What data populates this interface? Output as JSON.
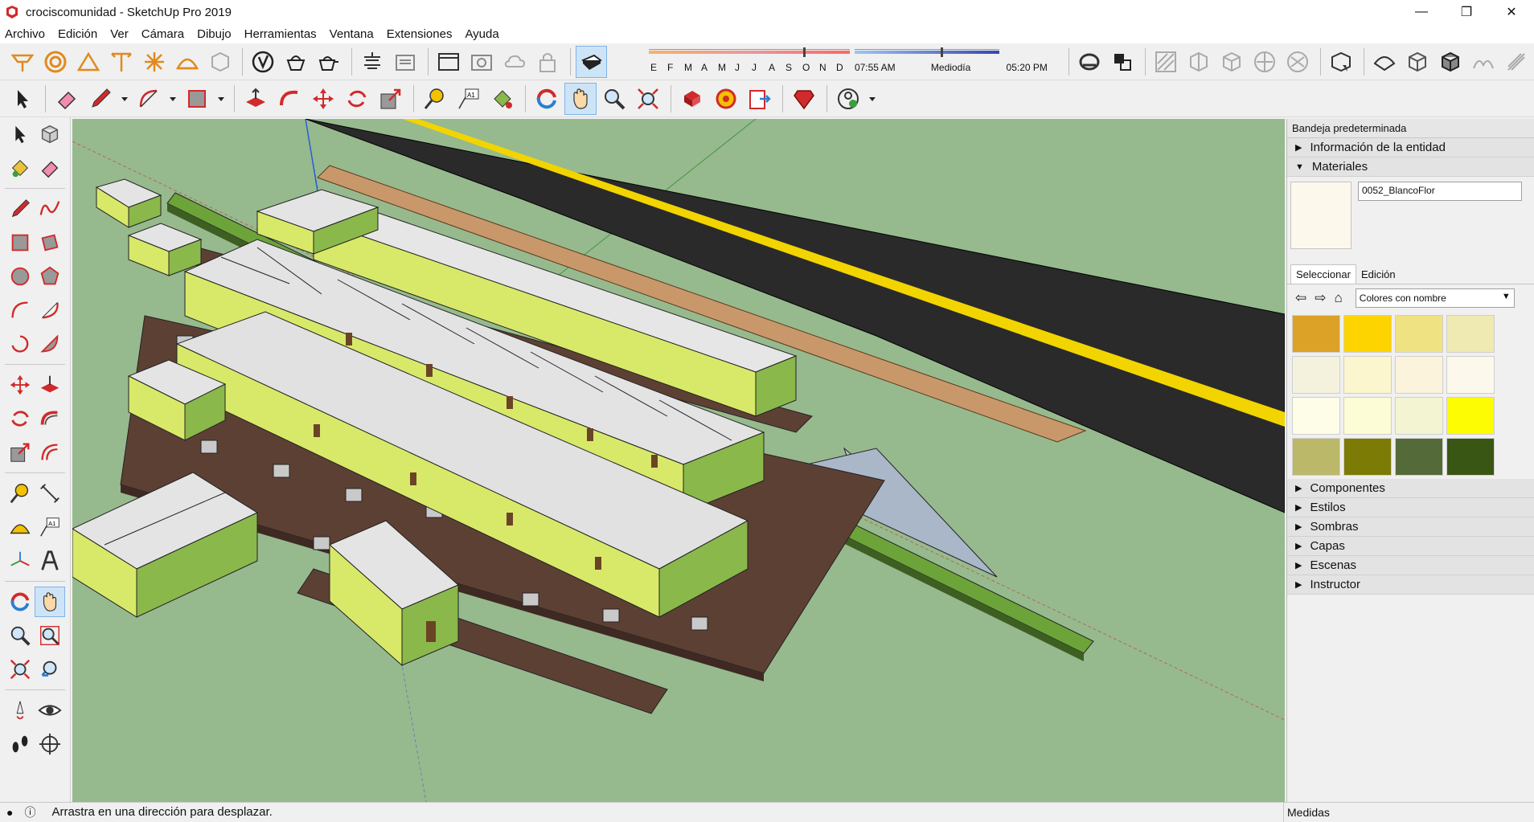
{
  "window": {
    "title": "crociscomunidad - SketchUp Pro 2019",
    "minimize_icon": "minimize-icon",
    "restore_icon": "restore-icon",
    "close_icon": "close-icon"
  },
  "menu": [
    "Archivo",
    "Edición",
    "Ver",
    "Cámara",
    "Dibujo",
    "Herramientas",
    "Ventana",
    "Extensiones",
    "Ayuda"
  ],
  "shadows": {
    "months": [
      "E",
      "F",
      "M",
      "A",
      "M",
      "J",
      "J",
      "A",
      "S",
      "O",
      "N",
      "D"
    ],
    "time_start": "07:55 AM",
    "time_mid": "Mediodía",
    "time_end": "05:20 PM"
  },
  "tray": {
    "title": "Bandeja predeterminada",
    "entity_info": "Información de la entidad",
    "materials": "Materiales",
    "material_name": "0052_BlancoFlor",
    "tab_select": "Seleccionar",
    "tab_edit": "Edición",
    "collection": "Colores con nombre",
    "sections": [
      "Componentes",
      "Estilos",
      "Sombras",
      "Capas",
      "Escenas",
      "Instructor"
    ]
  },
  "swatches": [
    "#dba227",
    "#fdd400",
    "#efe282",
    "#efe9b2",
    "#f4f2dc",
    "#fbf6ce",
    "#fcf3dc",
    "#fdf8ec",
    "#fdfde8",
    "#fcfcd6",
    "#f3f4d2",
    "#fdfc02",
    "#bcb86a",
    "#7b7b05",
    "#546b39",
    "#3a5614"
  ],
  "status": {
    "message": "Arrastra en una dirección para desplazar.",
    "measures_label": "Medidas"
  }
}
